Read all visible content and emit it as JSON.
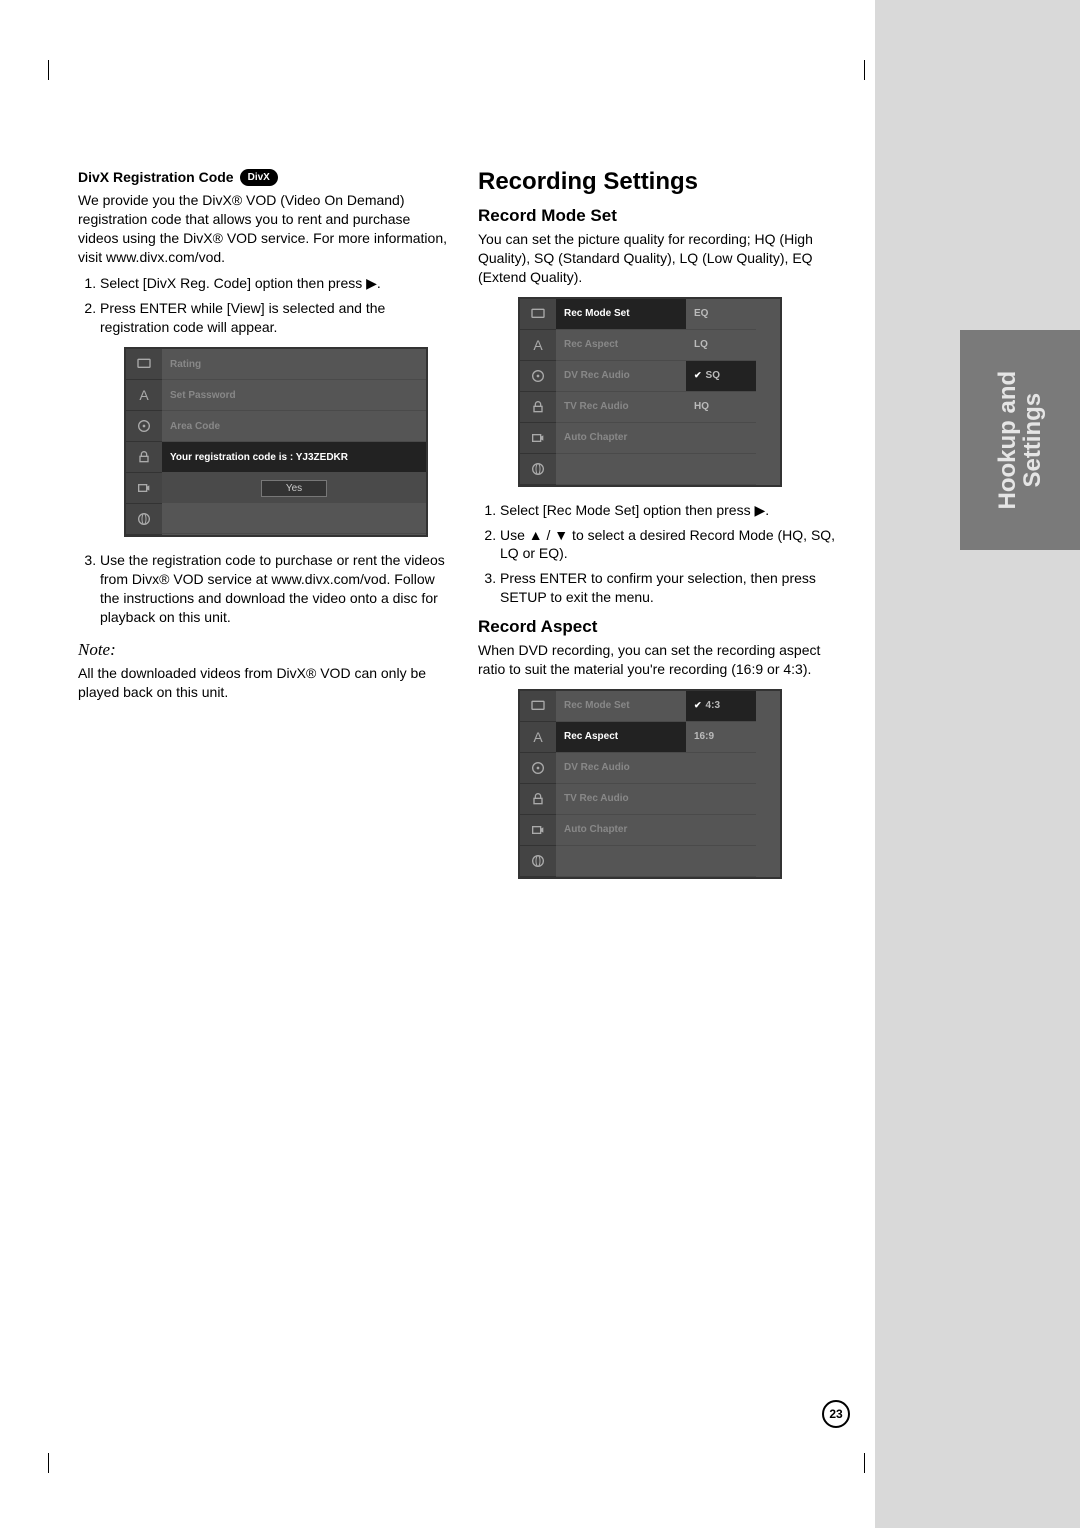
{
  "page_number": "23",
  "side_tab": "Hookup and\nSettings",
  "left": {
    "divx_heading": "DivX Registration Code",
    "divx_badge": "DivX",
    "divx_intro": "We provide you the DivX® VOD (Video On Demand) registration code that allows you to rent and purchase videos using the DivX® VOD service. For more information, visit www.divx.com/vod.",
    "divx_steps": [
      "Select [DivX Reg. Code] option then press ▶.",
      "Press ENTER while [View] is selected and the registration code will appear."
    ],
    "divx_step3": "Use the registration code to purchase or rent the videos from Divx® VOD service at www.divx.com/vod. Follow the instructions and download the video onto a disc for playback on this unit.",
    "note_title": "Note:",
    "note_body": "All the downloaded videos from DivX® VOD can only be played back on this unit.",
    "osd1": {
      "items": [
        "Rating",
        "Set Password",
        "Area Code"
      ],
      "msg": "Your registration code is : YJ3ZEDKR",
      "btn": "Yes"
    }
  },
  "right": {
    "title": "Recording Settings",
    "mode_heading": "Record Mode Set",
    "mode_intro": "You can set the picture quality for recording; HQ (High Quality), SQ (Standard Quality), LQ (Low Quality), EQ (Extend Quality).",
    "mode_steps": [
      "Select [Rec Mode Set] option then press ▶.",
      "Use ▲ / ▼ to select a desired Record Mode (HQ, SQ, LQ or EQ).",
      "Press ENTER to confirm your selection, then press SETUP to exit the menu."
    ],
    "aspect_heading": "Record Aspect",
    "aspect_intro": "When DVD recording, you can set the recording aspect ratio to suit the material you're recording (16:9 or 4:3).",
    "osd2": {
      "col1": [
        "Rec Mode Set",
        "Rec Aspect",
        "DV Rec Audio",
        "TV Rec Audio",
        "Auto Chapter"
      ],
      "hl": "Rec Mode Set",
      "col2": [
        "EQ",
        "LQ",
        "SQ",
        "HQ"
      ],
      "sel": "SQ"
    },
    "osd3": {
      "col1": [
        "Rec Mode Set",
        "Rec Aspect",
        "DV Rec Audio",
        "TV Rec Audio",
        "Auto Chapter"
      ],
      "hl": "Rec Aspect",
      "col2": [
        "4:3",
        "16:9"
      ],
      "sel": "4:3"
    }
  }
}
